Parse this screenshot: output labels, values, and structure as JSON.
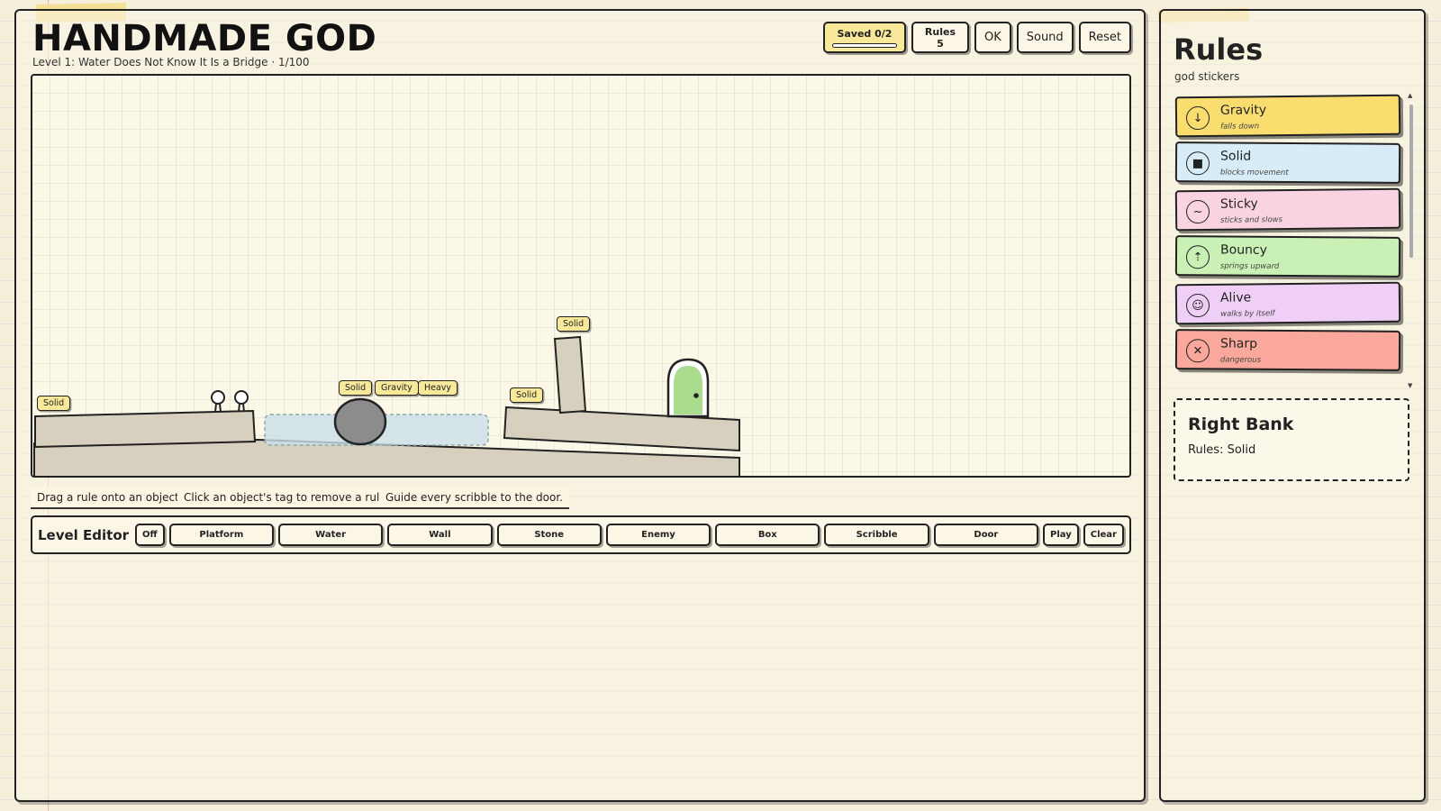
{
  "header": {
    "title": "HANDMADE GOD",
    "subtitle": "Level 1: Water Does Not Know It Is a Bridge · 1/100"
  },
  "top_buttons": {
    "saved": "Saved 0/2",
    "rules": "Rules 5",
    "ok": "OK",
    "sound": "Sound",
    "reset": "Reset"
  },
  "level": {
    "tags": {
      "left_platform": "Solid",
      "stone": [
        "Solid",
        "Gravity",
        "Heavy"
      ],
      "right_bank": "Solid",
      "pillar": "Solid"
    },
    "water_opacity_hint": "translucent"
  },
  "hints": [
    "Drag a rule onto an object.",
    "Click an object's tag to remove a rule.",
    "Guide every scribble to the door."
  ],
  "editor": {
    "title": "Level Editor",
    "off": "Off",
    "tools": [
      "Platform",
      "Water",
      "Wall",
      "Stone",
      "Enemy",
      "Box",
      "Scribble",
      "Door"
    ],
    "play": "Play",
    "clear": "Clear"
  },
  "sidebar": {
    "title": "Rules",
    "subtitle": "god stickers",
    "rules": [
      {
        "name": "Gravity",
        "desc": "falls down",
        "icon": "↓",
        "color": "#f9dd6f"
      },
      {
        "name": "Solid",
        "desc": "blocks movement",
        "icon": "■",
        "color": "#d7ecf7"
      },
      {
        "name": "Sticky",
        "desc": "sticks and slows",
        "icon": "~",
        "color": "#f9d3e2"
      },
      {
        "name": "Bouncy",
        "desc": "springs upward",
        "icon": "⇡",
        "color": "#c9f0b5"
      },
      {
        "name": "Alive",
        "desc": "walks by itself",
        "icon": "☺",
        "color": "#f0cff6"
      },
      {
        "name": "Sharp",
        "desc": "dangerous",
        "icon": "✕",
        "color": "#f9a89b"
      }
    ],
    "selected": {
      "title": "Right Bank",
      "rules": "Rules: Solid"
    }
  }
}
